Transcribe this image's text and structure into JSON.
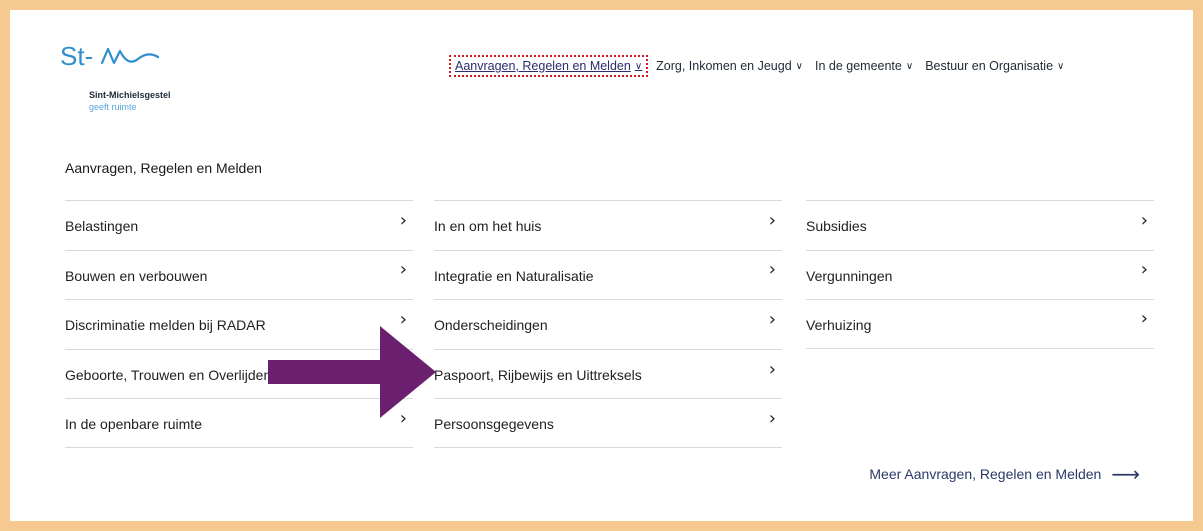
{
  "brand": {
    "mark": "St-",
    "name": "Sint-Michielsgestel",
    "tagline": "geeft ruimte",
    "color": "#2e8fd0"
  },
  "nav": {
    "items": [
      {
        "label": "Aanvragen, Regelen en Melden",
        "active": true
      },
      {
        "label": "Zorg, Inkomen en Jeugd",
        "active": false
      },
      {
        "label": "In de gemeente",
        "active": false
      },
      {
        "label": "Bestuur en Organisatie",
        "active": false
      }
    ],
    "chevron_icon": "chevron-down-icon"
  },
  "section": {
    "title": "Aanvragen, Regelen en Melden"
  },
  "menu": {
    "col1": [
      "Belastingen",
      "Bouwen en verbouwen",
      "Discriminatie melden bij RADAR",
      "Geboorte, Trouwen en Overlijden",
      "In de openbare ruimte"
    ],
    "col2": [
      "In en om het huis",
      "Integratie en Naturalisatie",
      "Onderscheidingen",
      "Paspoort, Rijbewijs en Uittreksels",
      "Persoonsgegevens"
    ],
    "col3": [
      "Subsidies",
      "Vergunningen",
      "Verhuizing"
    ],
    "row_icon": "chevron-right-icon",
    "chevron": "›"
  },
  "more": {
    "label": "Meer Aanvragen, Regelen en Melden",
    "icon": "arrow-right-icon",
    "glyph": "⟶"
  },
  "annotation": {
    "icon": "highlight-arrow-icon",
    "color": "#6b1f6f"
  },
  "colors": {
    "page_border": "#f5c98f",
    "active_outline": "#d11a1a",
    "link": "#2b3a67"
  }
}
